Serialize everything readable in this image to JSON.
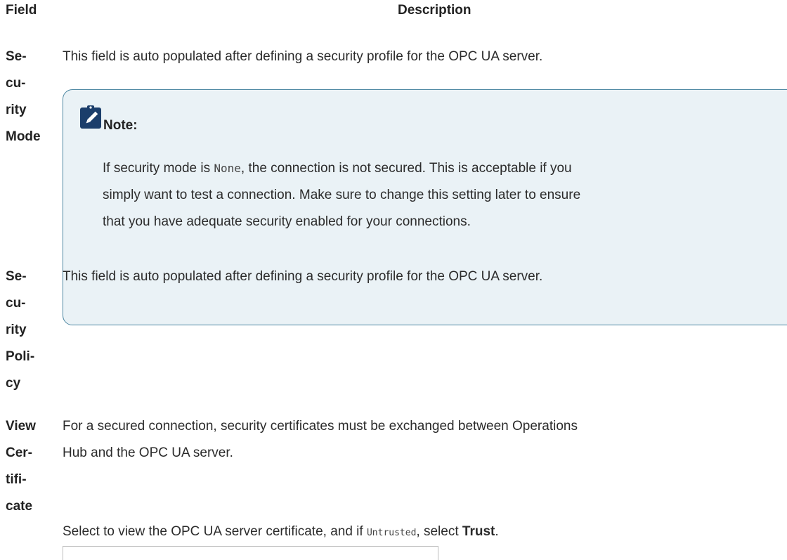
{
  "table": {
    "header_field": "Field",
    "header_description": "Description"
  },
  "rows": [
    {
      "field_parts": [
        "Se-",
        "cu-",
        "rity",
        "Mode"
      ],
      "description": "This field is auto populated after defining a security profile for the OPC UA server.",
      "note": {
        "title": "Note:",
        "line1_a": "If security mode is ",
        "line1_code": "None",
        "line1_b": ", the connection is not secured. This is acceptable if you",
        "line2": "simply want to test a connection. Make sure to change this setting later to ensure",
        "line3": "that you have adequate security enabled for your connections."
      }
    },
    {
      "field_parts": [
        "Se-",
        "cu-",
        "rity",
        "Poli-",
        "cy"
      ],
      "description": "This field is auto populated after defining a security profile for the OPC UA server."
    },
    {
      "field_parts": [
        "View",
        "Cer-",
        "tifi-",
        "cate"
      ],
      "description_line1": "For a secured connection, security certificates must be exchanged between Operations",
      "description_line2": "Hub and the OPC UA server.",
      "instruction_a": "Select to view the OPC UA server certificate, and if ",
      "instruction_code": "Untrusted",
      "instruction_b": ", select ",
      "instruction_bold": "Trust",
      "instruction_c": "."
    }
  ],
  "icons": {
    "note_icon": "clipboard-pencil-icon",
    "note_icon_color": "#1b3e6b"
  },
  "colors": {
    "note_background": "#eaf2f6",
    "note_border": "#4d87a2"
  }
}
